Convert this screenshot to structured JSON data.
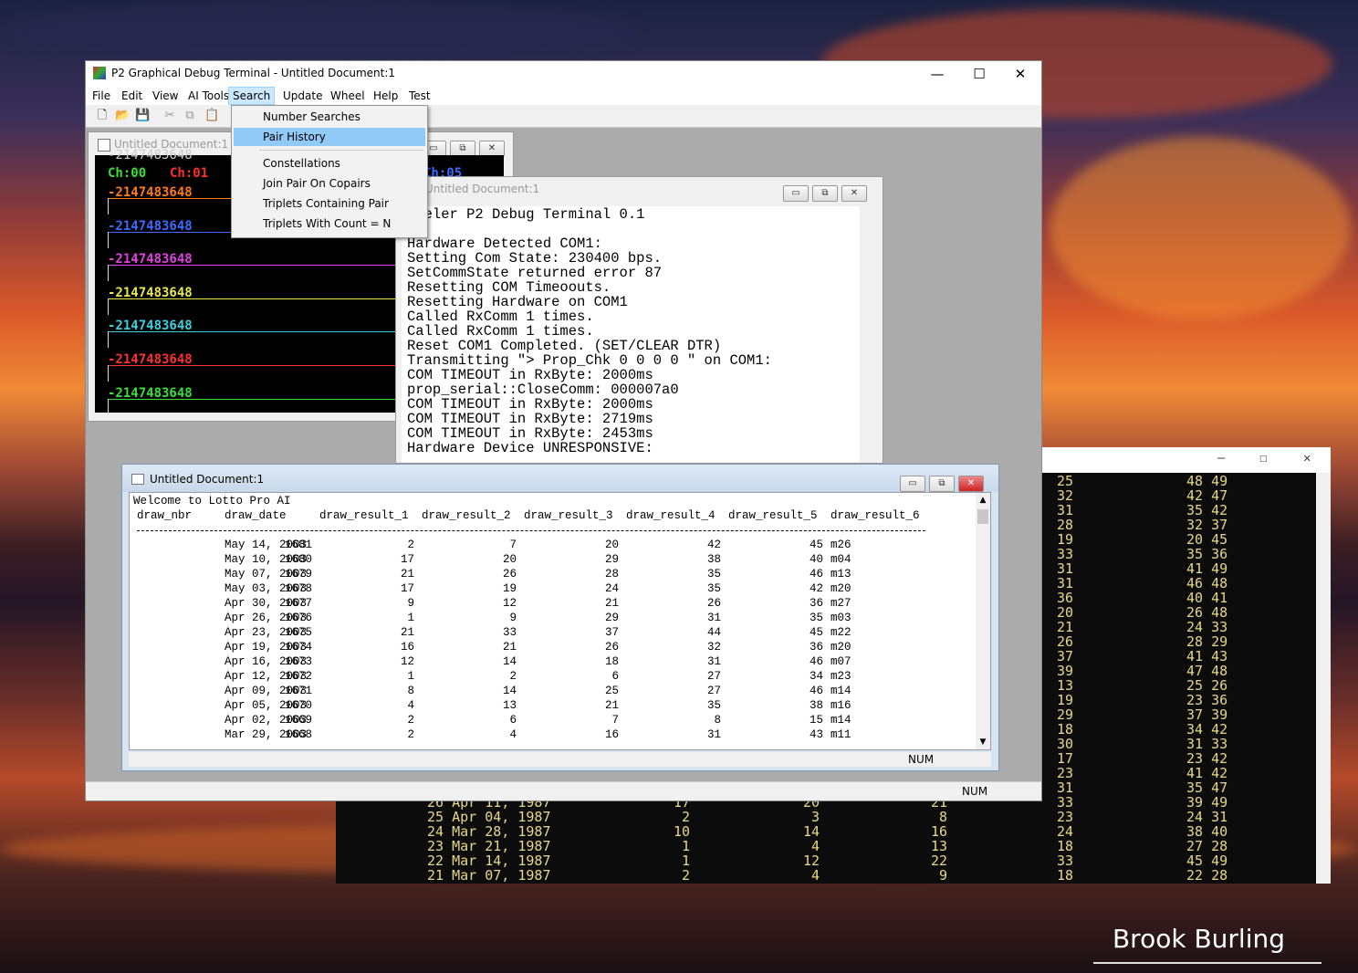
{
  "desktop": {
    "signature": "Brook Burling"
  },
  "background_console": {
    "caption_buttons": [
      "—",
      "☐",
      "✕"
    ],
    "right_rows": [
      [
        "25",
        "48 49"
      ],
      [
        "32",
        "42 47"
      ],
      [
        "31",
        "35 42"
      ],
      [
        "28",
        "32 37"
      ],
      [
        "19",
        "20 45"
      ],
      [
        "33",
        "35 36"
      ],
      [
        "31",
        "41 49"
      ],
      [
        "31",
        "46 48"
      ],
      [
        "36",
        "40 41"
      ],
      [
        "20",
        "26 48"
      ],
      [
        "21",
        "24 33"
      ],
      [
        "26",
        "28 29"
      ],
      [
        "37",
        "41 43"
      ],
      [
        "39",
        "47 48"
      ],
      [
        "13",
        "25 26"
      ],
      [
        "19",
        "23 36"
      ],
      [
        "29",
        "37 39"
      ],
      [
        "18",
        "34 42"
      ],
      [
        "30",
        "31 33"
      ],
      [
        "17",
        "23 42"
      ],
      [
        "23",
        "41 42"
      ],
      [
        "31",
        "35 47"
      ],
      [
        "33",
        "39 49"
      ],
      [
        "23",
        "24 31"
      ],
      [
        "24",
        "38 40"
      ],
      [
        "18",
        "27 28"
      ],
      [
        "33",
        "45 49"
      ],
      [
        "18",
        "22 28"
      ]
    ],
    "left_rows": [
      [
        "26 Apr 11, 1987",
        "17",
        "20",
        "21"
      ],
      [
        "25 Apr 04, 1987",
        "2",
        "3",
        "8"
      ],
      [
        "24 Mar 28, 1987",
        "10",
        "14",
        "16"
      ],
      [
        "23 Mar 21, 1987",
        "1",
        "4",
        "13"
      ],
      [
        "22 Mar 14, 1987",
        "1",
        "12",
        "22"
      ],
      [
        "21 Mar 07, 1987",
        "2",
        "4",
        "9"
      ]
    ]
  },
  "app": {
    "title": "P2 Graphical Debug Terminal - Untitled Document:1",
    "caption_buttons": {
      "minimize": "—",
      "maximize": "☐",
      "close": "✕"
    },
    "menu": [
      "File",
      "Edit",
      "View",
      "AI Tools",
      "Search",
      "Update",
      "Wheel",
      "Help",
      "Test"
    ],
    "toolbar_icons": [
      "new-icon",
      "open-icon",
      "save-icon",
      "cut-icon",
      "copy-icon",
      "paste-icon"
    ],
    "status": {
      "num": "NUM"
    }
  },
  "search_menu": {
    "items": [
      "Number Searches",
      "Pair History",
      "Constellations",
      "Join Pair On Copairs",
      "Triplets Containing Pair",
      "Triplets With Count = N"
    ],
    "selected": "Pair History"
  },
  "scope_window": {
    "title": "Untitled Document:1",
    "header_top": "-2147483648",
    "ch_labels": [
      "Ch:00",
      "Ch:01",
      "Ch:05"
    ],
    "traces": [
      {
        "value": "-2147483648",
        "color": "#ff7a1a"
      },
      {
        "value": "-2147483648",
        "color": "#3a6bff"
      },
      {
        "value": "-2147483648",
        "color": "#e040e0"
      },
      {
        "value": "-2147483648",
        "color": "#e8e84a"
      },
      {
        "value": "-2147483648",
        "color": "#39d0e0"
      },
      {
        "value": "-2147483648",
        "color": "#ff3030"
      },
      {
        "value": "-2147483648",
        "color": "#38e038"
      }
    ]
  },
  "terminal_window": {
    "title": "Untitled Document:1",
    "lines": [
      "opeler P2 Debug Terminal 0.1",
      "",
      "Hardware Detected COM1:",
      "Setting Com State: 230400 bps.",
      "SetCommState returned error 87",
      "Resetting COM Timeoouts.",
      "Resetting Hardware on COM1",
      "Called RxComm 1 times.",
      "Called RxComm 1 times.",
      "Reset COM1 Completed. (SET/CLEAR DTR)",
      "Transmitting \"> Prop_Chk 0 0 0 0 \" on COM1:",
      "COM TIMEOUT in RxByte: 2000ms",
      "prop_serial::CloseComm: 000007a0",
      "COM TIMEOUT in RxByte: 2000ms",
      "COM TIMEOUT in RxByte: 2719ms",
      "COM TIMEOUT in RxByte: 2453ms",
      "Hardware Device UNRESPONSIVE:"
    ]
  },
  "lotto_window": {
    "title": "Untitled Document:1",
    "welcome": "Welcome to Lotto Pro AI",
    "columns": [
      "draw_nbr",
      "draw_date",
      "draw_result_1",
      "draw_result_2",
      "draw_result_3",
      "draw_result_4",
      "draw_result_5",
      "draw_result_6"
    ],
    "rows": [
      [
        "1681",
        "May 14, 2003",
        "2",
        "7",
        "20",
        "42",
        "45",
        "m26"
      ],
      [
        "1680",
        "May 10, 2003",
        "17",
        "20",
        "29",
        "38",
        "40",
        "m04"
      ],
      [
        "1679",
        "May 07, 2003",
        "21",
        "26",
        "28",
        "35",
        "46",
        "m13"
      ],
      [
        "1678",
        "May 03, 2003",
        "17",
        "19",
        "24",
        "35",
        "42",
        "m20"
      ],
      [
        "1677",
        "Apr 30, 2003",
        "9",
        "12",
        "21",
        "26",
        "36",
        "m27"
      ],
      [
        "1676",
        "Apr 26, 2003",
        "1",
        "9",
        "29",
        "31",
        "35",
        "m03"
      ],
      [
        "1675",
        "Apr 23, 2003",
        "21",
        "33",
        "37",
        "44",
        "45",
        "m22"
      ],
      [
        "1674",
        "Apr 19, 2003",
        "16",
        "21",
        "26",
        "32",
        "36",
        "m20"
      ],
      [
        "1673",
        "Apr 16, 2003",
        "12",
        "14",
        "18",
        "31",
        "46",
        "m07"
      ],
      [
        "1672",
        "Apr 12, 2003",
        "1",
        "2",
        "6",
        "27",
        "34",
        "m23"
      ],
      [
        "1671",
        "Apr 09, 2003",
        "8",
        "14",
        "25",
        "27",
        "46",
        "m14"
      ],
      [
        "1670",
        "Apr 05, 2003",
        "4",
        "13",
        "21",
        "35",
        "38",
        "m16"
      ],
      [
        "1669",
        "Apr 02, 2003",
        "2",
        "6",
        "7",
        "8",
        "15",
        "m14"
      ],
      [
        "1668",
        "Mar 29, 2003",
        "2",
        "4",
        "16",
        "31",
        "43",
        "m11"
      ]
    ],
    "status": {
      "num": "NUM"
    }
  }
}
